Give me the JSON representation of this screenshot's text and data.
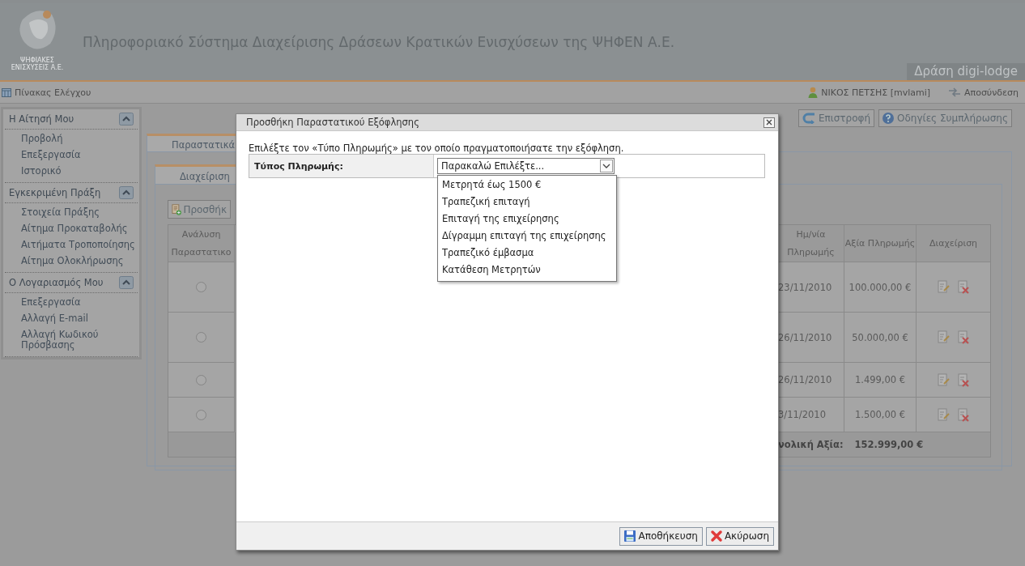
{
  "header": {
    "logo_lines": [
      "ΨΗΦΙΑΚΕΣ",
      "ΕΝΙΣΧΥΣΕΙΣ Α.Ε."
    ],
    "title": "Πληροφοριακό Σύστημα Διαχείρισης Δράσεων Κρατικών Ενισχύσεων της ΨΗΦΕΝ Α.Ε.",
    "action_name": "Δράση digi-lodge"
  },
  "toolbar": {
    "dashboard": "Πίνακας Ελέγχου",
    "user": "ΝΙΚΟΣ ΠΕΤΣΗΣ [mvlami]",
    "logout": "Αποσύνδεση"
  },
  "sidebar": {
    "sections": [
      {
        "title": "Η Αίτησή Μου",
        "expanded": true,
        "items": [
          "Προβολή",
          "Επεξεργασία",
          "Ιστορικό"
        ]
      },
      {
        "title": "Εγκεκριμένη Πράξη",
        "expanded": true,
        "items": [
          "Στοιχεία Πράξης",
          "Αίτημα Προκαταβολής",
          "Αιτήματα Τροποποίησης",
          "Αίτημα Ολοκλήρωσης"
        ]
      },
      {
        "title": "Ο Λογαριασμός Μου",
        "expanded": true,
        "items": [
          "Επεξεργασία",
          "Αλλαγή E-mail",
          "Αλλαγή Κωδικού Πρόσβασης"
        ]
      }
    ]
  },
  "page_buttons": [
    {
      "label": "Επιστροφή",
      "kind": "return"
    },
    {
      "label": "Οδηγίες Συμπλήρωσης",
      "kind": "help"
    }
  ],
  "tabs": [
    {
      "label": "Παραστατικά",
      "selected": true
    }
  ],
  "subtabs": [
    {
      "label": "Διαχείριση",
      "selected": true
    }
  ],
  "add_button": "Προσθήκ",
  "table": {
    "columns": [
      "Ανάλυση Παραστατικο",
      "Ημ/νία Πληρωμής",
      "Αξία Πληρωμής",
      "Διαχείριση"
    ],
    "rows": [
      {
        "selected": false,
        "date": "23/11/2010",
        "amount": "100.000,00 €"
      },
      {
        "selected": false,
        "date": "26/11/2010",
        "amount": "50.000,00 €"
      },
      {
        "selected": false,
        "date": "26/11/2010",
        "amount": "1.499,00 €"
      },
      {
        "selected": false,
        "date": "3/11/2010",
        "amount": "1.500,00 €"
      }
    ],
    "total": {
      "label": "νολική Αξία:",
      "value": "152.999,00 €"
    }
  },
  "dialog": {
    "title": "Προσθήκη Παραστατικού Εξόφλησης",
    "instruction": "Επιλέξτε τον «Τύπο Πληρωμής» με τον οποίο πραγματοποιήσατε την εξόφληση.",
    "field_label": "Τύπος Πληρωμής:",
    "select_value": "Παρακαλώ Επιλέξτε...",
    "options": [
      {
        "label": "Μετρητά έως 1500 €",
        "selected": false
      },
      {
        "label": "Τραπεζική επιταγή",
        "selected": false
      },
      {
        "label": "Επιταγή της επιχείρησης",
        "selected": false
      },
      {
        "label": "Δίγραμμη επιταγή της επιχείρησης",
        "selected": false
      },
      {
        "label": "Τραπεζικό έμβασμα",
        "selected": false
      },
      {
        "label": "Κατάθεση Μετρητών",
        "selected": false
      }
    ],
    "buttons": [
      {
        "label": "Αποθήκευση",
        "kind": "save"
      },
      {
        "label": "Ακύρωση",
        "kind": "cancel"
      }
    ]
  }
}
